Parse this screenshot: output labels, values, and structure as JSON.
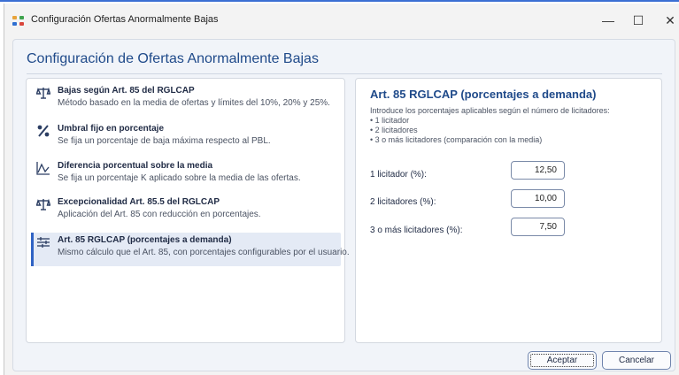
{
  "window": {
    "title": "Configuración Ofertas Anormalmente Bajas",
    "minimize": "—",
    "maximize": "☐",
    "close": "✕"
  },
  "dialog": {
    "title": "Configuración de Ofertas Anormalmente Bajas"
  },
  "options": [
    {
      "icon": "scales-icon",
      "name": "Bajas según Art. 85 del RGLCAP",
      "description": "Método basado en la media de ofertas y límites del 10%, 20% y 25%.",
      "selected": false
    },
    {
      "icon": "percent-icon",
      "name": "Umbral fijo en porcentaje",
      "description": "Se fija un porcentaje de baja máxima respecto al PBL.",
      "selected": false
    },
    {
      "icon": "trend-chart-icon",
      "name": "Diferencia porcentual sobre la media",
      "description": "Se fija un porcentaje K aplicado sobre la media de las ofertas.",
      "selected": false
    },
    {
      "icon": "scales-icon",
      "name": "Excepcionalidad Art. 85.5 del RGLCAP",
      "description": "Aplicación del Art. 85 con reducción en porcentajes.",
      "selected": false
    },
    {
      "icon": "sliders-icon",
      "name": "Art. 85 RGLCAP (porcentajes a demanda)",
      "description": "Mismo cálculo que el Art. 85, con porcentajes configurables por el usuario.",
      "selected": true
    }
  ],
  "detail": {
    "title": "Art. 85 RGLCAP (porcentajes a demanda)",
    "intro": "Introduce los porcentajes aplicables según el número de licitadores:",
    "bullets": [
      "1 licitador",
      "2 licitadores",
      "3 o más licitadores (comparación con la media)"
    ],
    "fields": [
      {
        "label": "1 licitador (%):",
        "value": "12,50"
      },
      {
        "label": "2 licitadores (%):",
        "value": "10,00"
      },
      {
        "label": "3 o más licitadores (%):",
        "value": "7,50"
      }
    ]
  },
  "buttons": {
    "accept": "Aceptar",
    "cancel": "Cancelar"
  },
  "colors": {
    "accent": "#2f62c4",
    "title": "#1f4a8a",
    "selected_bg": "#e4eaf5",
    "app_icon": [
      "#e8a33a",
      "#3fa34d",
      "#2f6fd1",
      "#d9463b"
    ]
  }
}
